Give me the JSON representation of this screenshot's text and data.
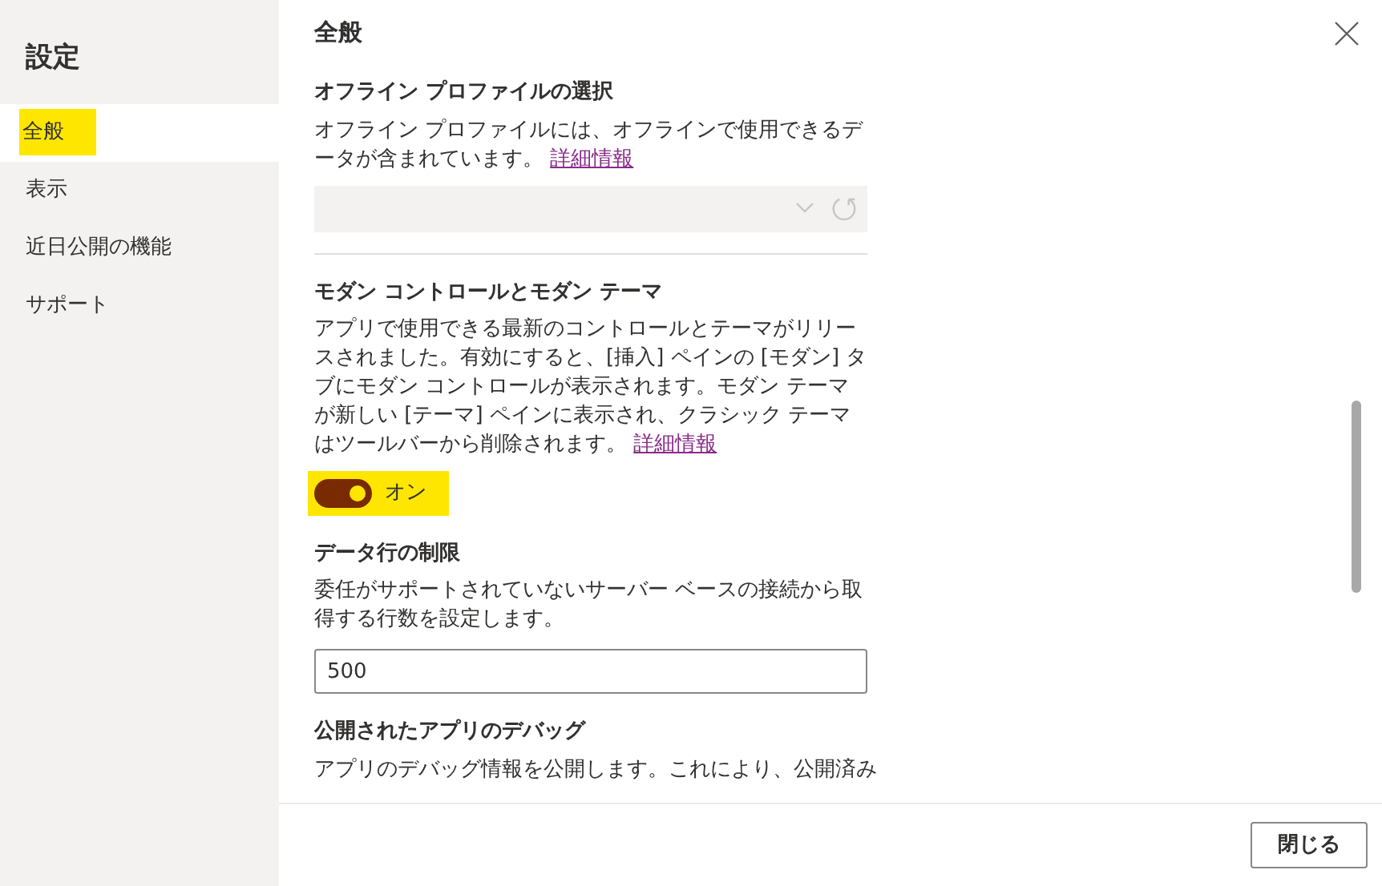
{
  "sidebar": {
    "title": "設定",
    "items": [
      {
        "label": "全般",
        "selected": true,
        "highlighted": true
      },
      {
        "label": "表示",
        "selected": false,
        "highlighted": false
      },
      {
        "label": "近日公開の機能",
        "selected": false,
        "highlighted": false
      },
      {
        "label": "サポート",
        "selected": false,
        "highlighted": false
      }
    ]
  },
  "panel": {
    "title": "全般",
    "sections": [
      {
        "kind": "dropdown",
        "heading": "オフライン プロファイルの選択",
        "description": "オフライン プロファイルには、オフラインで使用できるデータが含まれています。",
        "link": "詳細情報",
        "disabled": true,
        "divider": true
      },
      {
        "kind": "toggle",
        "heading": "モダン コントロールとモダン テーマ",
        "description": "アプリで使用できる最新のコントロールとテーマがリリースされました。有効にすると、[挿入] ペインの [モダン] タブにモダン コントロールが表示されます。モダン テーマが新しい [テーマ] ペインに表示され、クラシック テーマはツールバーから削除されます。",
        "link": "詳細情報",
        "on": true,
        "state_label": "オン",
        "highlighted": true
      },
      {
        "kind": "input",
        "heading": "データ行の制限",
        "description": "委任がサポートされていないサーバー ベースの接続から取得する行数を設定します。",
        "value": "500"
      },
      {
        "kind": "text",
        "heading": "公開されたアプリのデバッグ",
        "description": "アプリのデバッグ情報を公開します。これにより、公開済み"
      }
    ]
  },
  "footer": {
    "button": "閉じる"
  }
}
